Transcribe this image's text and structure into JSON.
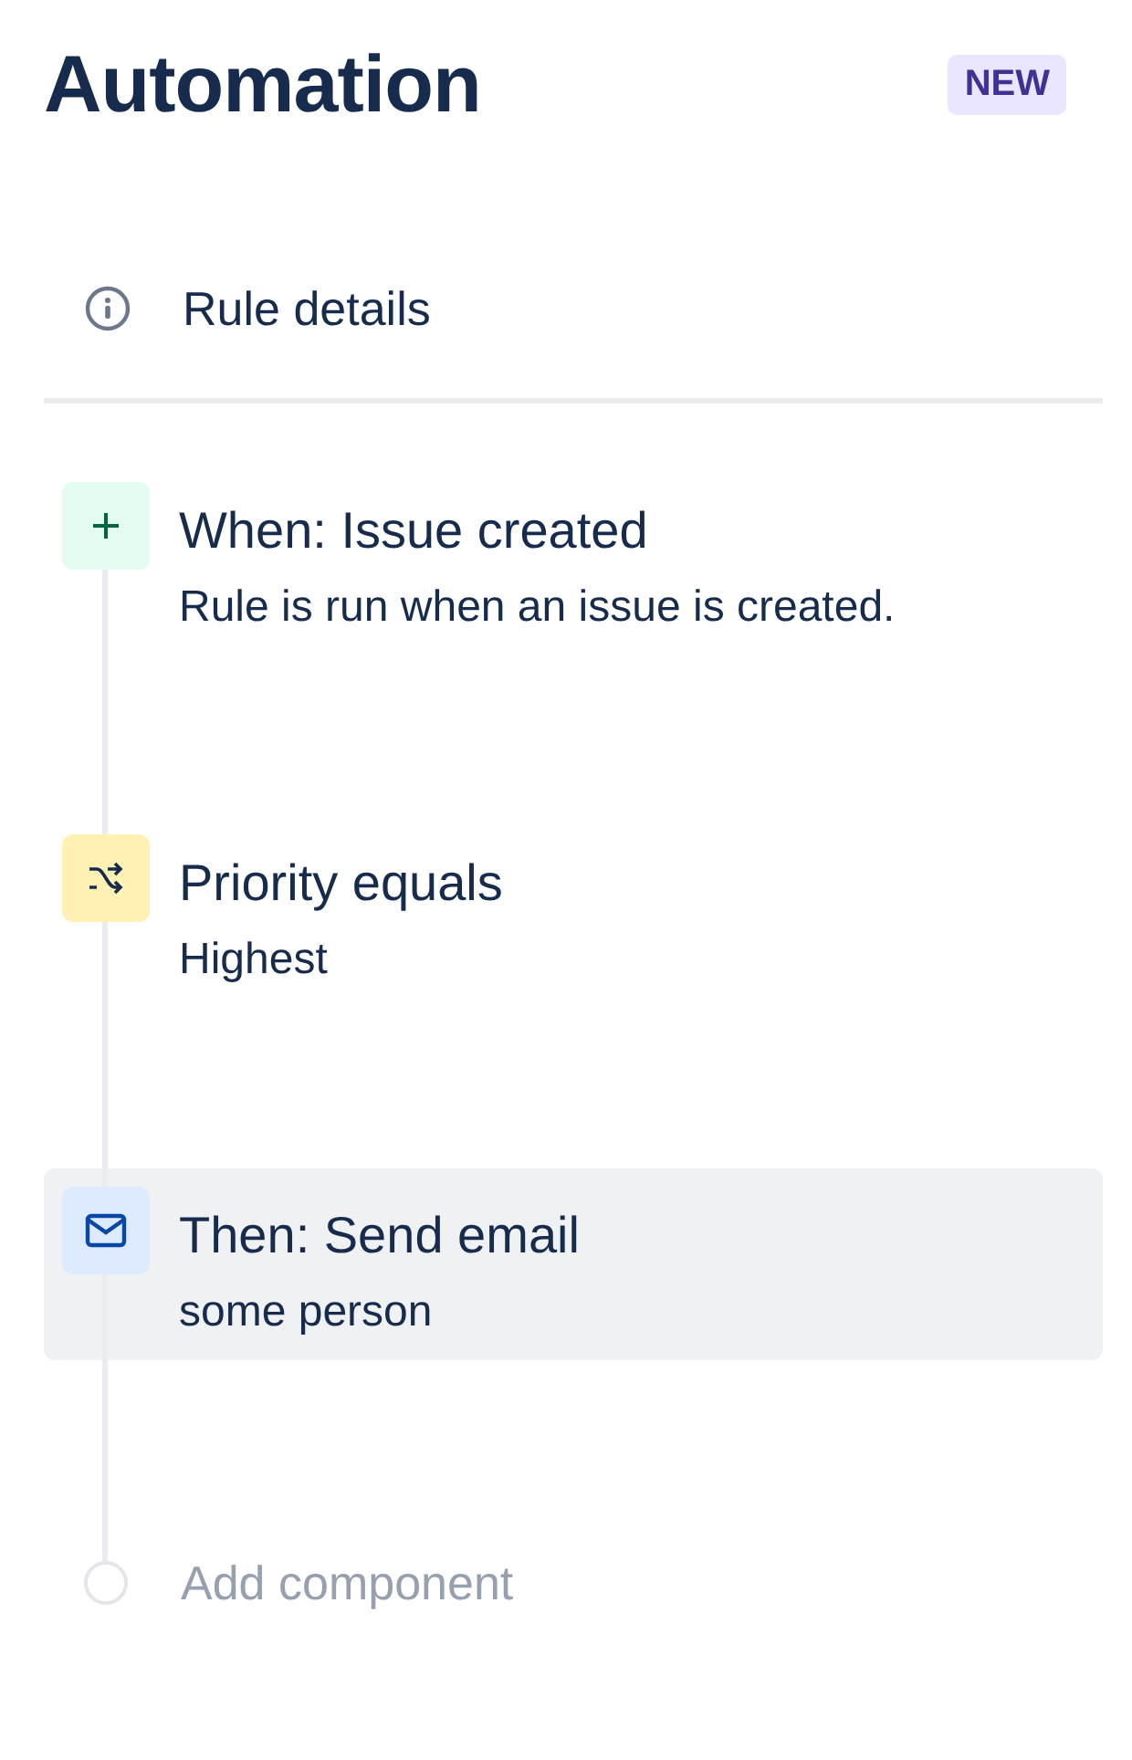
{
  "header": {
    "title": "Automation",
    "badge": "NEW"
  },
  "rule_details": {
    "label": "Rule details"
  },
  "components": [
    {
      "kind": "trigger",
      "title": "When: Issue created",
      "description": "Rule is run when an issue is created.",
      "selected": false
    },
    {
      "kind": "condition",
      "title": "Priority equals",
      "description": "Highest",
      "selected": false
    },
    {
      "kind": "action",
      "title": "Then: Send email",
      "description": "some person",
      "selected": true
    }
  ],
  "add_component": {
    "label": "Add component"
  }
}
